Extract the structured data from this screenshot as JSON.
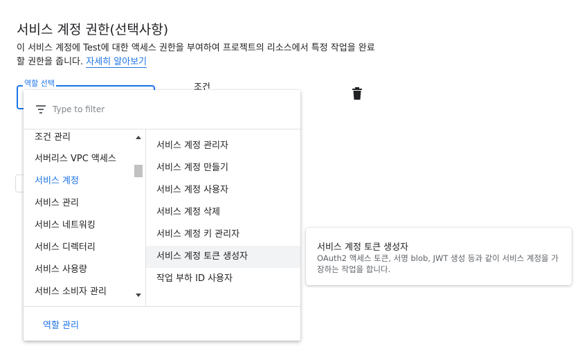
{
  "section": {
    "title": "서비스 계정 권한(선택사항)",
    "description": "이 서비스 계정에 Test에 대한 액세스 권한을 부여하여 프로젝트의 리소스에서 특정 작업을 완료할 권한을 줍니다.",
    "learn_more": "자세히 알아보기"
  },
  "role_field": {
    "label": "역할 선택"
  },
  "condition_label": "조건",
  "icons": {
    "delete": "trash-icon",
    "filter": "filter-icon"
  },
  "dropdown": {
    "filter_placeholder": "Type to filter",
    "categories": [
      "조건 관리",
      "서버리스 VPC 액세스",
      "서비스 계정",
      "서비스 관리",
      "서비스 네트워킹",
      "서비스 디렉터리",
      "서비스 사용량",
      "서비스 소비자 관리"
    ],
    "selected_category": "서비스 계정",
    "roles": [
      "서비스 계정 관리자",
      "서비스 계정 만들기",
      "서비스 계정 사용자",
      "서비스 계정 삭제",
      "서비스 계정 키 관리자",
      "서비스 계정 토큰 생성자",
      "작업 부하 ID 사용자"
    ],
    "hovered_role": "서비스 계정 토큰 생성자",
    "manage_roles": "역할 관리"
  },
  "tooltip": {
    "title": "서비스 계정 토큰 생성자",
    "description": "OAuth2 액세스 토큰, 서명 blob, JWT 생성 등과 같이 서비스 계정을 가장하는 작업을 합니다."
  },
  "colors": {
    "accent": "#1a73e8",
    "text": "#202124",
    "muted": "#5f6368"
  }
}
